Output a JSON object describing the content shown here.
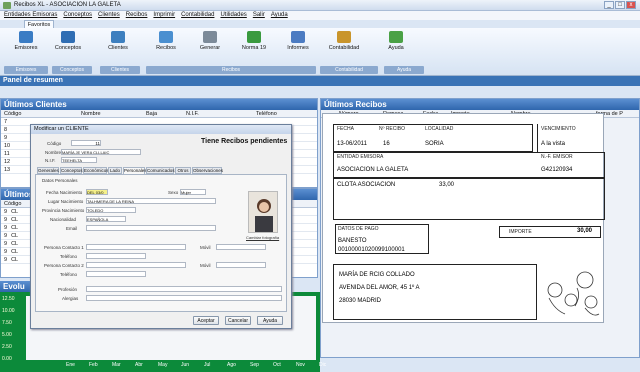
{
  "window": {
    "title": "Recibos XL - ASOCIACION LA GALETA"
  },
  "menu": [
    "Entidades Emisoras",
    "Conceptos",
    "Clientes",
    "Recibos",
    "Imprimir",
    "Contabilidad",
    "Utilidades",
    "Salir",
    "Ayuda"
  ],
  "ribbon": {
    "tab": "Favoritos",
    "buttons": [
      "Emisores",
      "Conceptos",
      "Clientes",
      "Recibos",
      "Generar",
      "Norma 19",
      "Informes",
      "Contabilidad",
      "Ayuda"
    ],
    "groups": [
      "Emisores",
      "Conceptos",
      "Clientes",
      "Recibos",
      "Contabilidad",
      "Ayuda"
    ]
  },
  "summary_title": "Panel de resumen",
  "clients_panel": {
    "title": "Últimos Clientes",
    "columns": [
      "Código",
      "Nombre",
      "Baja",
      "N.I.F.",
      "Teléfono"
    ],
    "rows": [
      "7",
      "8",
      "9",
      "10",
      "11",
      "12",
      "13"
    ]
  },
  "other_panel": {
    "title": "Últimos",
    "col": "Código",
    "rows": [
      "9",
      "9",
      "9",
      "9",
      "9",
      "9",
      "9"
    ],
    "row_prefix": "CL"
  },
  "evolution_panel": {
    "title": "Evolu",
    "yticks": [
      "12.50",
      "10.00",
      "7.50",
      "5.00",
      "2.50",
      "0.00"
    ],
    "months": [
      "Ene",
      "Feb",
      "Mar",
      "Abr",
      "May",
      "Jun",
      "Jul",
      "Ago",
      "Sep",
      "Oct",
      "Nov",
      "Dic"
    ]
  },
  "receipts_panel": {
    "title": "Últimos Recibos",
    "columns": [
      "Número",
      "Remesa",
      "Fecha",
      "Importe",
      "Nombre",
      "forma de P"
    ]
  },
  "receipt": {
    "fecha_l": "FECHA",
    "fecha_v": "13-06/2011",
    "num_l": "Nº RECIBO",
    "num_v": "16",
    "loc_l": "LOCALIDAD",
    "loc_v": "SORIA",
    "venc_l": "VENCIMIENTO",
    "venc_v": "A la vista",
    "ent_l": "ENTIDAD EMISORA",
    "ent_v": "ASOCIACION LA GALETA",
    "nif_l": "N.-F. EMISOR",
    "nif_v": "G42120934",
    "concept": "CLOTA ASOCIACION",
    "concept_amt": "33,00",
    "datos_l": "DATOS DE PAGO",
    "bank": "BANESTO",
    "account": "00100001020099100001",
    "importe_l": "IMPORTE",
    "importe_v": "30,00",
    "addr1": "MARÍA DE RCIG COLLADO",
    "addr2": "AVENIDA DEL AMOR, 45 1º A",
    "addr3": "28030 MADRID"
  },
  "modal": {
    "title": "Modificar un CLIENTE",
    "codigo_l": "Código",
    "codigo_v": "11",
    "header": "Tiene Recibos pendientes",
    "nombre_l": "Nombre",
    "nombre_v": "MARÍA JE VERA CLLLAIC",
    "nif_l": "N.I.F.",
    "nif_v": "TEEHELTA",
    "tabs": [
      "Generales",
      "Conceptos",
      "Económicos",
      "Lado",
      "Personales",
      "Comunicados",
      "Otros",
      "Observaciones"
    ],
    "section": "Datos Personales",
    "fnac_l": "Fecha Nacimiento",
    "fnac_v": "DEL 03/0",
    "sexo_l": "Sexo",
    "sexo_v": "Mujer",
    "lnac_l": "Lugar Nacimiento",
    "lnac_v": "TALHMERA DE LA REINA",
    "pnac_l": "Provincia Nacimiento",
    "pnac_v": "TOLEDO",
    "nac_l": "Nacionalidad",
    "nac_v": "ESPAÑOLA",
    "email_l": "Email",
    "photo_cap": "Cambiar fotografía",
    "p1_l": "Persona Contacto 1",
    "t1_l": "Teléfono",
    "m1_l": "Móvil",
    "p2_l": "Persona Contacto 2",
    "t2_l": "Teléfono",
    "m2_l": "Móvil",
    "prof_l": "Profesión",
    "aficiones_l": "Alergias",
    "aceptar": "Aceptar",
    "cancelar": "Cancelar",
    "ayuda": "Ayuda"
  }
}
